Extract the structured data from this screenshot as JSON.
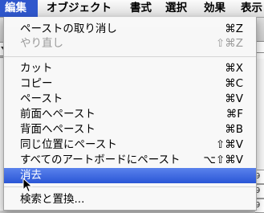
{
  "menubar": {
    "items": [
      {
        "label": "編集"
      },
      {
        "label": "オブジェクト"
      },
      {
        "label": "書式"
      },
      {
        "label": "選択"
      },
      {
        "label": "効果"
      },
      {
        "label": "表示"
      }
    ]
  },
  "menu": {
    "items": [
      {
        "label": "ペーストの取り消し",
        "shortcut": "⌘Z",
        "enabled": true
      },
      {
        "label": "やり直し",
        "shortcut": "⇧⌘Z",
        "enabled": false
      },
      {
        "label": "カット",
        "shortcut": "⌘X",
        "enabled": true
      },
      {
        "label": "コピー",
        "shortcut": "⌘C",
        "enabled": true
      },
      {
        "label": "ペースト",
        "shortcut": "⌘V",
        "enabled": true
      },
      {
        "label": "前面へペースト",
        "shortcut": "⌘F",
        "enabled": true
      },
      {
        "label": "背面へペースト",
        "shortcut": "⌘B",
        "enabled": true
      },
      {
        "label": "同じ位置にペースト",
        "shortcut": "⇧⌘V",
        "enabled": true
      },
      {
        "label": "すべてのアートボードにペースト",
        "shortcut": "⌥⇧⌘V",
        "enabled": true
      },
      {
        "label": "消去",
        "shortcut": "",
        "enabled": true,
        "highlighted": true
      },
      {
        "label": "検索と置換...",
        "shortcut": "",
        "enabled": true
      }
    ]
  },
  "background": {
    "row_values": [
      "9",
      "9",
      "9"
    ]
  },
  "colors": {
    "highlight": "#2a56d6",
    "disabled_text": "#9a9a9a"
  }
}
